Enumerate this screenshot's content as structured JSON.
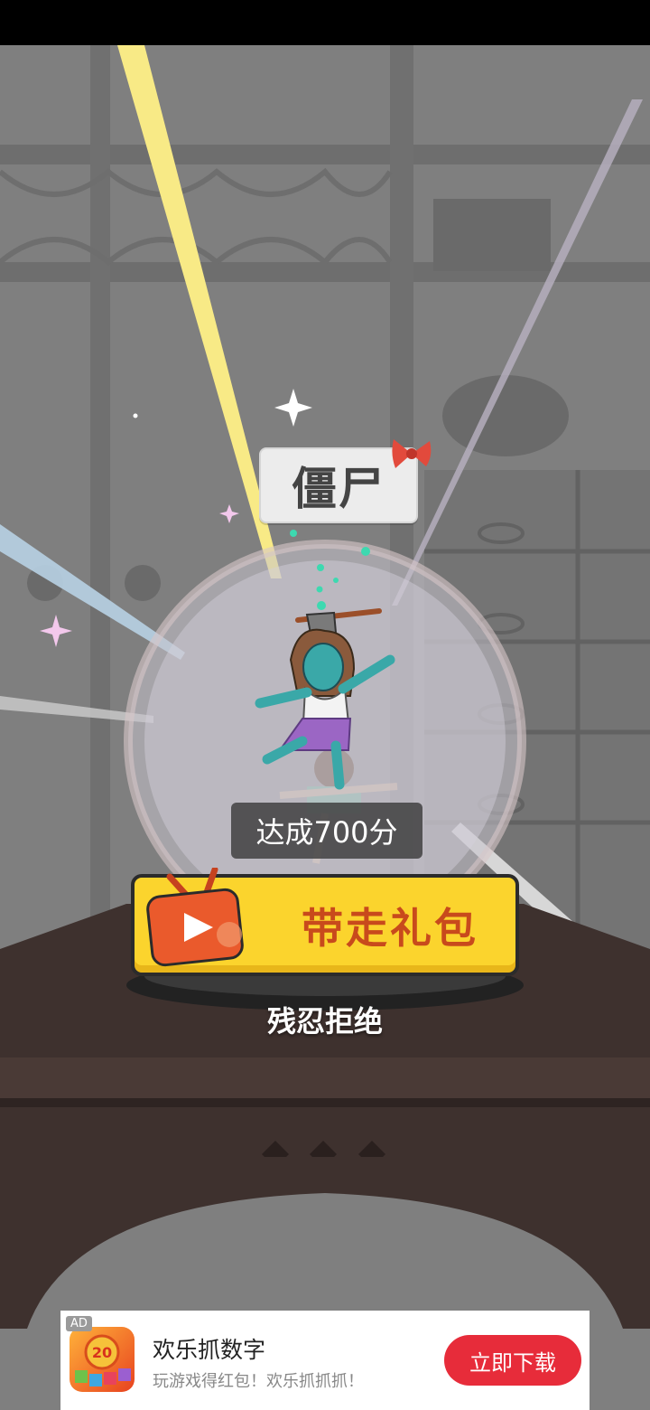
{
  "game": {
    "character_title": "僵尸",
    "score_text": "达成700分",
    "take_gift_label": "带走礼包",
    "reject_label": "残忍拒绝"
  },
  "ad": {
    "badge": "AD",
    "title": "欢乐抓数字",
    "subtitle": "玩游戏得红包！欢乐抓抓抓！",
    "download_label": "立即下载",
    "icon_number": "20"
  },
  "colors": {
    "button_yellow": "#fbd42d",
    "button_text": "#c84a1c",
    "tv_icon": "#ea5a2c",
    "download_red": "#e72c3a"
  },
  "icons": [
    "bow-icon",
    "tv-play-icon",
    "sparkle-icon",
    "zombie-character"
  ]
}
